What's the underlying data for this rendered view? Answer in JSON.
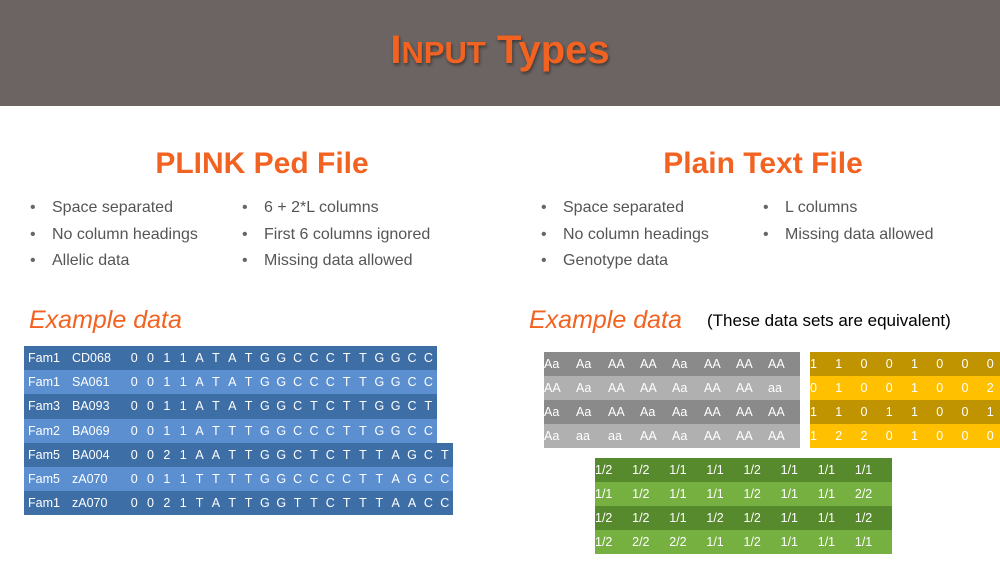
{
  "slide": {
    "title_first": "I",
    "title_small": "NPUT",
    "title_rest": " Types"
  },
  "left": {
    "title": "PLINK Ped File",
    "bullets_col1": [
      "Space separated",
      "No column headings",
      "Allelic data"
    ],
    "bullets_col2": [
      "6 + 2*L columns",
      "First 6 columns ignored",
      "Missing data allowed"
    ],
    "example_label": "Example data",
    "table": [
      {
        "fam": "Fam1",
        "id": "CD068",
        "values": [
          "0",
          "0",
          "1",
          "1",
          "A",
          "T",
          "A",
          "T",
          "G",
          "G",
          "C",
          "C",
          "C",
          "T",
          "T",
          "G",
          "G",
          "C",
          "C"
        ]
      },
      {
        "fam": "Fam1",
        "id": "SA061",
        "values": [
          "0",
          "0",
          "1",
          "1",
          "A",
          "T",
          "A",
          "T",
          "G",
          "G",
          "C",
          "C",
          "C",
          "T",
          "T",
          "G",
          "G",
          "C",
          "C"
        ]
      },
      {
        "fam": "Fam3",
        "id": "BA093",
        "values": [
          "0",
          "0",
          "1",
          "1",
          "A",
          "T",
          "A",
          "T",
          "G",
          "G",
          "C",
          "T",
          "C",
          "T",
          "T",
          "G",
          "G",
          "C",
          "T"
        ]
      },
      {
        "fam": "Fam2",
        "id": "BA069",
        "values": [
          "0",
          "0",
          "1",
          "1",
          "A",
          "T",
          "T",
          "T",
          "G",
          "G",
          "C",
          "C",
          "C",
          "T",
          "T",
          "G",
          "G",
          "C",
          "C"
        ]
      },
      {
        "fam": "Fam5",
        "id": "BA004",
        "values": [
          "0",
          "0",
          "2",
          "1",
          "A",
          "A",
          "T",
          "T",
          "G",
          "G",
          "C",
          "T",
          "C",
          "T",
          "T",
          "T",
          "A",
          "G",
          "C",
          "T"
        ]
      },
      {
        "fam": "Fam5",
        "id": "zA070",
        "values": [
          "0",
          "0",
          "1",
          "1",
          "T",
          "T",
          "T",
          "T",
          "G",
          "G",
          "C",
          "C",
          "C",
          "C",
          "T",
          "T",
          "A",
          "G",
          "C",
          "C"
        ]
      },
      {
        "fam": "Fam1",
        "id": "zA070",
        "values": [
          "0",
          "0",
          "2",
          "1",
          "T",
          "A",
          "T",
          "T",
          "G",
          "G",
          "T",
          "T",
          "C",
          "T",
          "T",
          "T",
          "A",
          "A",
          "C",
          "C"
        ]
      }
    ]
  },
  "right": {
    "title": "Plain Text File",
    "bullets_col1": [
      "Space separated",
      "No column headings",
      "Genotype data"
    ],
    "bullets_col2": [
      "L columns",
      "Missing data allowed"
    ],
    "example_label": "Example data",
    "note": "(These data sets are equivalent)",
    "table_letters": [
      [
        "Aa",
        "Aa",
        "AA",
        "AA",
        "Aa",
        "AA",
        "AA",
        "AA"
      ],
      [
        "AA",
        "Aa",
        "AA",
        "AA",
        "Aa",
        "AA",
        "AA",
        "aa"
      ],
      [
        "Aa",
        "Aa",
        "AA",
        "Aa",
        "Aa",
        "AA",
        "AA",
        "AA"
      ],
      [
        "Aa",
        "aa",
        "aa",
        "AA",
        "Aa",
        "AA",
        "AA",
        "AA"
      ]
    ],
    "table_numbers": [
      [
        "1",
        "1",
        "0",
        "0",
        "1",
        "0",
        "0",
        "0"
      ],
      [
        "0",
        "1",
        "0",
        "0",
        "1",
        "0",
        "0",
        "2"
      ],
      [
        "1",
        "1",
        "0",
        "1",
        "1",
        "0",
        "0",
        "1"
      ],
      [
        "1",
        "2",
        "2",
        "0",
        "1",
        "0",
        "0",
        "0"
      ]
    ],
    "table_slash": [
      [
        "1/2",
        "1/2",
        "1/1",
        "1/1",
        "1/2",
        "1/1",
        "1/1",
        "1/1"
      ],
      [
        "1/1",
        "1/2",
        "1/1",
        "1/1",
        "1/2",
        "1/1",
        "1/1",
        "2/2"
      ],
      [
        "1/2",
        "1/2",
        "1/1",
        "1/2",
        "1/2",
        "1/1",
        "1/1",
        "1/2"
      ],
      [
        "1/2",
        "2/2",
        "2/2",
        "1/1",
        "1/2",
        "1/1",
        "1/1",
        "1/1"
      ]
    ]
  }
}
